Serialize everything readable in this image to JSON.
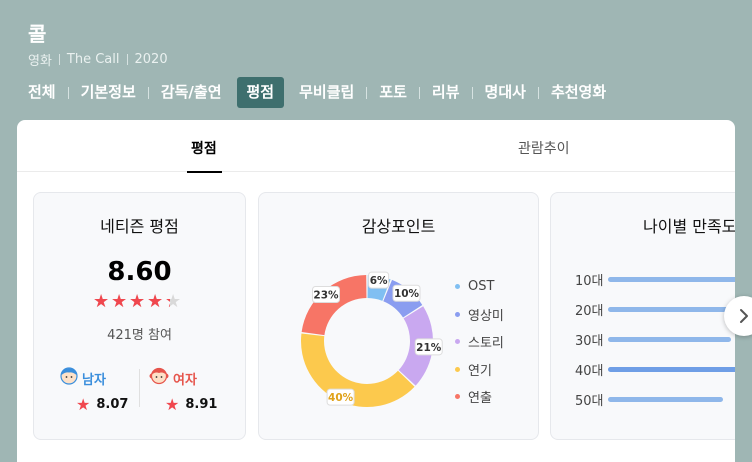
{
  "movie": {
    "title": "콜",
    "meta": [
      "영화",
      "The Call",
      "2020"
    ]
  },
  "nav": {
    "tabs": [
      {
        "label": "전체"
      },
      {
        "label": "기본정보"
      },
      {
        "label": "감독/출연"
      },
      {
        "label": "평점",
        "active": true
      },
      {
        "label": "무비클립"
      },
      {
        "label": "포토"
      },
      {
        "label": "리뷰"
      },
      {
        "label": "명대사"
      },
      {
        "label": "추천영화"
      }
    ]
  },
  "subtabs": {
    "active": "평점",
    "other": "관람추이"
  },
  "netizen": {
    "title": "네티즌 평점",
    "score": "8.60",
    "star_rating": 4.3,
    "star_max": 5,
    "participants": "421명 참여",
    "male": {
      "label": "남자",
      "score": "8.07"
    },
    "female": {
      "label": "여자",
      "score": "8.91"
    }
  },
  "points": {
    "title": "감상포인트",
    "chart_data": {
      "type": "pie",
      "categories": [
        "OST",
        "영상미",
        "스토리",
        "연기",
        "연출"
      ],
      "values": [
        6,
        10,
        21,
        40,
        23
      ],
      "labels": [
        "6%",
        "10%",
        "21%",
        "40%",
        "23%"
      ],
      "colors": [
        "#80bff2",
        "#8a9df0",
        "#c9a8f0",
        "#fcc94d",
        "#f77566"
      ]
    }
  },
  "age": {
    "title": "나이별 만족도",
    "rows": [
      {
        "label": "10대",
        "value": 0.95
      },
      {
        "label": "20대",
        "value": 1.0
      },
      {
        "label": "30대",
        "value": 0.88
      },
      {
        "label": "40대",
        "value": 1.0,
        "top": true
      },
      {
        "label": "50대",
        "value": 0.82
      }
    ]
  },
  "colors": {
    "header_bg": "#9fb6b4",
    "active_tab": "#3e6f6e",
    "star": "#f0474e",
    "male": "#3a8edc",
    "female": "#e6554c"
  }
}
